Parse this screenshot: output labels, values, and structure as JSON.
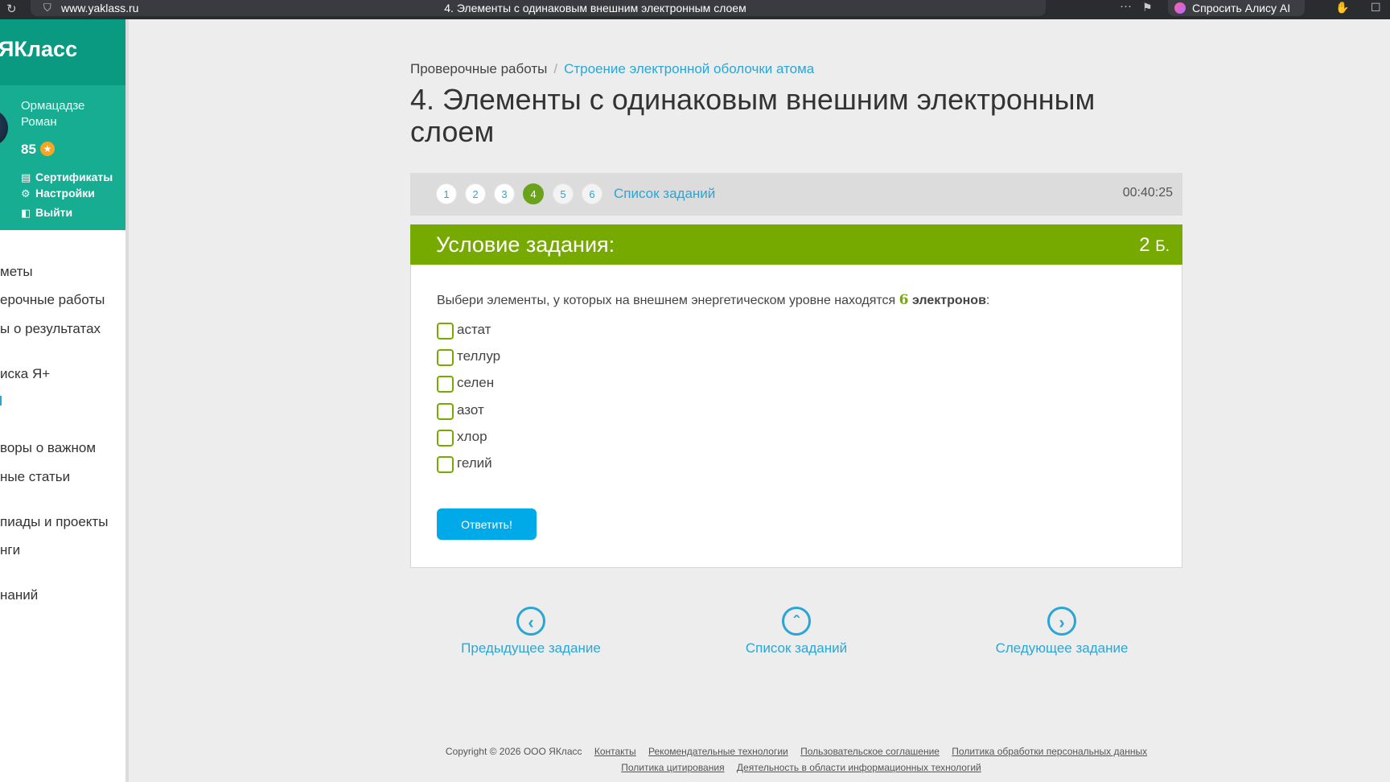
{
  "browser": {
    "url": "www.yaklass.ru",
    "tab_title": "4. Элементы с одинаковым внешним электронным слоем",
    "dots": "···",
    "alice_label": "Спросить Алису AI"
  },
  "sidebar": {
    "logo": "ЯКласс",
    "user_name": "Ормацадзе Роман",
    "points": "85",
    "links": [
      "Сертификаты",
      "Настройки",
      "Выйти"
    ],
    "nav": [
      "меты",
      "ерочные работы",
      "ы о результатах",
      "иска Я+",
      "воры о важном",
      "ные статьи",
      "пиады и проекты",
      "нги",
      "наний"
    ]
  },
  "breadcrumb": {
    "root": "Проверочные работы",
    "separator": "/",
    "current": "Строение электронной оболочки атома"
  },
  "page_title": "4. Элементы с одинаковым внешним электронным слоем",
  "tasks": {
    "numbers": [
      "1",
      "2",
      "3",
      "4",
      "5",
      "6"
    ],
    "active_index": 3,
    "list_link": "Список заданий",
    "timer": "00:40:25"
  },
  "card": {
    "heading": "Условие задания:",
    "points": "2",
    "points_unit": "Б.",
    "question_pre": "Выбери элементы, у которых на внешнем энергетическом уровне находятся ",
    "question_number": "6",
    "question_bold": " электронов",
    "question_post": ":",
    "options": [
      "астат",
      "теллур",
      "селен",
      "азот",
      "хлор",
      "гелий"
    ],
    "answer_button": "Ответить!"
  },
  "bottom_nav": {
    "prev": "Предыдущее задание",
    "list": "Список заданий",
    "next": "Следующее задание"
  },
  "footer": {
    "copyright": "Copyright © 2026 ООО ЯКласс",
    "links_line1": [
      "Контакты",
      "Рекомендательные технологии",
      "Пользовательское соглашение",
      "Политика обработки персональных данных"
    ],
    "links_line2": [
      "Политика цитирования",
      "Деятельность в области информационных технологий"
    ]
  },
  "colors": {
    "brand_green": "#77aa00",
    "teal": "#16ad93",
    "link_blue": "#2aa6d6",
    "button_blue": "#00a9e8"
  }
}
